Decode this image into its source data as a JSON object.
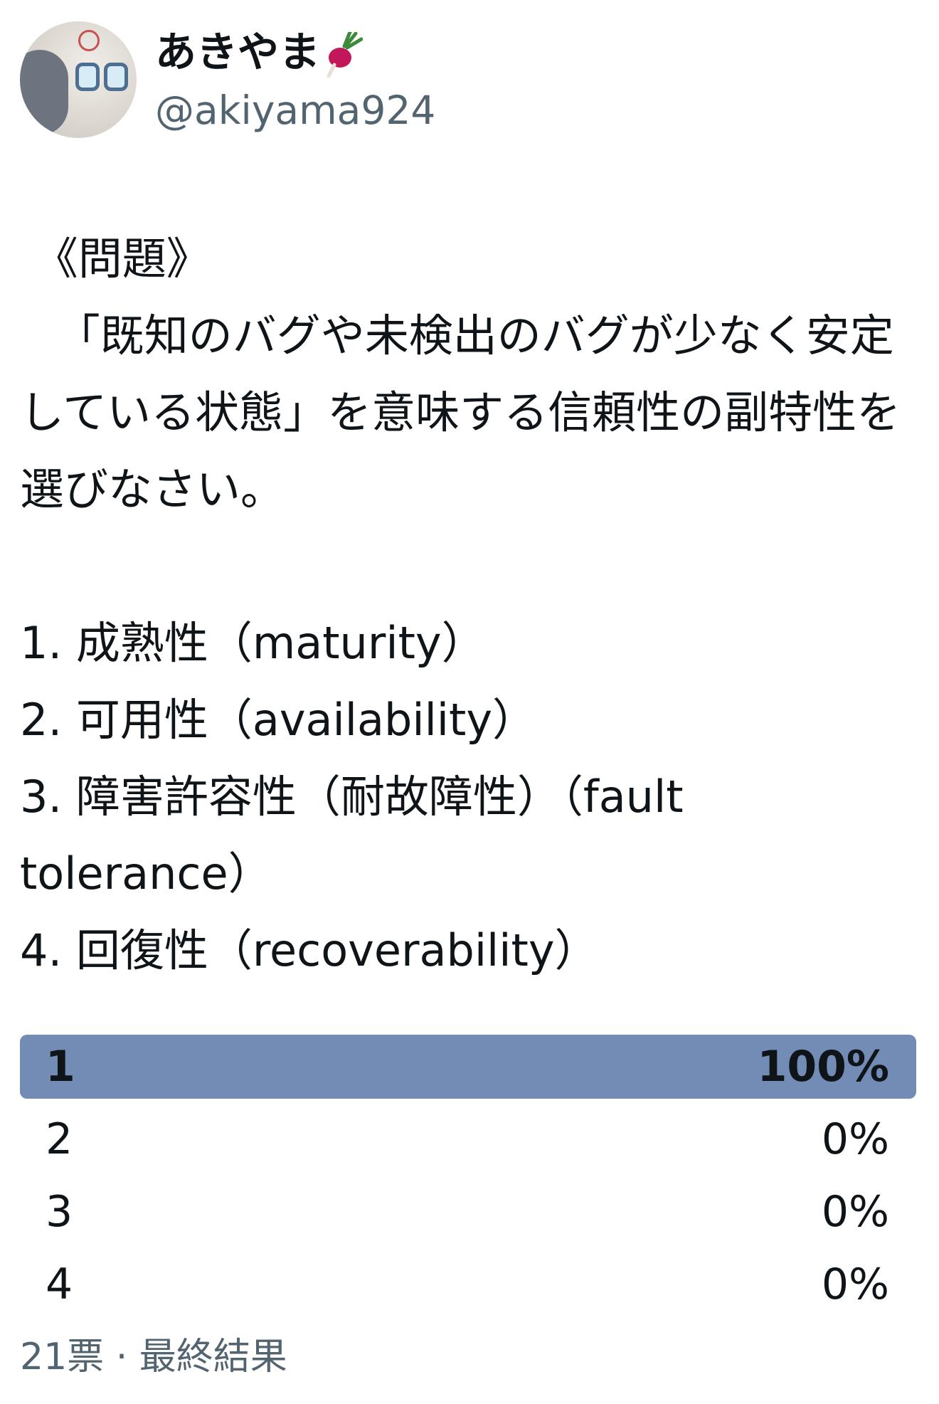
{
  "author": {
    "display_name": "あきやま",
    "handle": "@akiyama924",
    "name_emoji_icon": "radish-icon"
  },
  "tweet": {
    "text": " 《問題》\n 　「既知のバグや未検出のバグが少なく安定している状態」を意味する信頼性の副特性を選びなさい。\n\n1. 成熟性（maturity）\n2. 可用性（availability）\n3. 障害許容性（耐故障性）（fault tolerance）\n4. 回復性（recoverability）"
  },
  "poll": {
    "options": [
      {
        "label": "1",
        "percent_text": "100%",
        "share": 1.0,
        "winner": true
      },
      {
        "label": "2",
        "percent_text": "0%",
        "share": 0.0,
        "winner": false
      },
      {
        "label": "3",
        "percent_text": "0%",
        "share": 0.0,
        "winner": false
      },
      {
        "label": "4",
        "percent_text": "0%",
        "share": 0.0,
        "winner": false
      }
    ],
    "meta": "21票 · 最終結果",
    "winner_color": "#728cb6"
  }
}
